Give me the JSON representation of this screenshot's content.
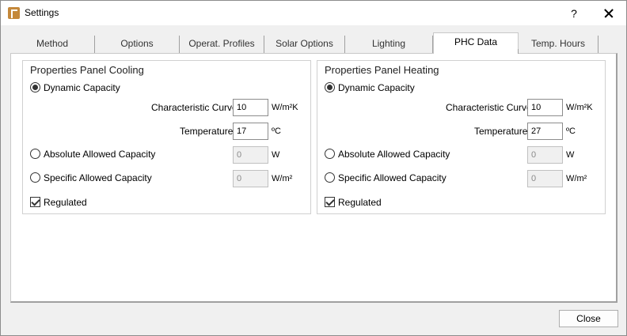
{
  "window": {
    "title": "Settings",
    "help_label": "?"
  },
  "tabs": [
    {
      "label": "Method"
    },
    {
      "label": "Options"
    },
    {
      "label": "Operat. Profiles"
    },
    {
      "label": "Solar Options"
    },
    {
      "label": "Lighting"
    },
    {
      "label": "PHC Data"
    },
    {
      "label": "Temp. Hours"
    }
  ],
  "active_tab": "PHC Data",
  "cooling": {
    "title": "Properties Panel Cooling",
    "dynamic_label": "Dynamic Capacity",
    "curve_label": "Characteristic Curve",
    "curve_value": "10",
    "curve_unit": "W/m²K",
    "temp_label": "Temperature",
    "temp_value": "17",
    "temp_unit": "ºC",
    "absolute_label": "Absolute Allowed Capacity",
    "absolute_value": "0",
    "absolute_unit": "W",
    "specific_label": "Specific Allowed Capacity",
    "specific_value": "0",
    "specific_unit": "W/m²",
    "regulated_label": "Regulated"
  },
  "heating": {
    "title": "Properties Panel Heating",
    "dynamic_label": "Dynamic Capacity",
    "curve_label": "Characteristic Curve",
    "curve_value": "10",
    "curve_unit": "W/m²K",
    "temp_label": "Temperature",
    "temp_value": "27",
    "temp_unit": "ºC",
    "absolute_label": "Absolute Allowed Capacity",
    "absolute_value": "0",
    "absolute_unit": "W",
    "specific_label": "Specific Allowed Capacity",
    "specific_value": "0",
    "specific_unit": "W/m²",
    "regulated_label": "Regulated"
  },
  "footer": {
    "close_label": "Close"
  }
}
